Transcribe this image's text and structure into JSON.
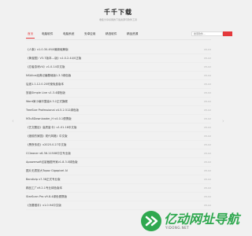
{
  "header": {
    "title": "千千下载",
    "subtitle": "收集分享好用的下载资源与软件工具"
  },
  "nav": {
    "items": [
      "首页",
      "电脑软件",
      "电脑系统",
      "安卓应用",
      "精选软件",
      "精品资源"
    ],
    "search_placeholder": "搜索软件..."
  },
  "list": [
    {
      "title": "《人事》v1.0.30.49/0最新破解版",
      "date": "05-03"
    },
    {
      "title": "《黄雀图》V3.7版本---版》v1.0.2.44/0正版",
      "date": "05-02"
    },
    {
      "title": "《忍者游戏V4》v1.0.14中文版",
      "date": "05-02"
    },
    {
      "title": "NSAlice经典记编基础版1.3.3绿色版",
      "date": "05-02"
    },
    {
      "title": "后遗1.1.12.0.20可使免费版本",
      "date": "05-02"
    },
    {
      "title": "放者Simple Live v1.3.4绿色版",
      "date": "05-02"
    },
    {
      "title": "Word家小编平整高4.3.2正式旗舰",
      "date": "05-02"
    },
    {
      "title": "TreeSize Professional v4.5.2.512绿色版",
      "date": "05-02"
    },
    {
      "title": "M3u8Downloader_H v4.0.1便携版",
      "date": "05-02"
    },
    {
      "title": "《艺文题目》高质量卡》v1.01.18中文版",
      "date": "05-02"
    },
    {
      "title": "《渡前的家园》现代风格》中文版",
      "date": "05-02"
    },
    {
      "title": "《黑夜传说》v2025.0.27中文版",
      "date": "05-02"
    },
    {
      "title": "CCleaner v6.36.11508中文专业版",
      "date": "05-02"
    },
    {
      "title": "Apowersoft幻影截图专家v1.8.3.0绿色版",
      "date": "05-02"
    },
    {
      "title": "图片无损放大Topaz Gigapixel AI",
      "date": "05-02"
    },
    {
      "title": "Bandizip v7.38正式专业版",
      "date": "05-02"
    },
    {
      "title": "精品工厂v9.2.1专业绿色版本",
      "date": "05-02"
    },
    {
      "title": "StarScan Pro v9.8.4绿色便携版",
      "date": "05-02"
    },
    {
      "title": "《怎要猎手》v1.0.94中文版",
      "date": "05-02"
    }
  ],
  "pager": {
    "prev": "‹",
    "next": "›"
  },
  "watermark": {
    "text": "亿动网址导航",
    "url": "YIDONG.NET"
  },
  "colors": {
    "accent": "#e4393c",
    "watermark": "#2fa84f"
  }
}
